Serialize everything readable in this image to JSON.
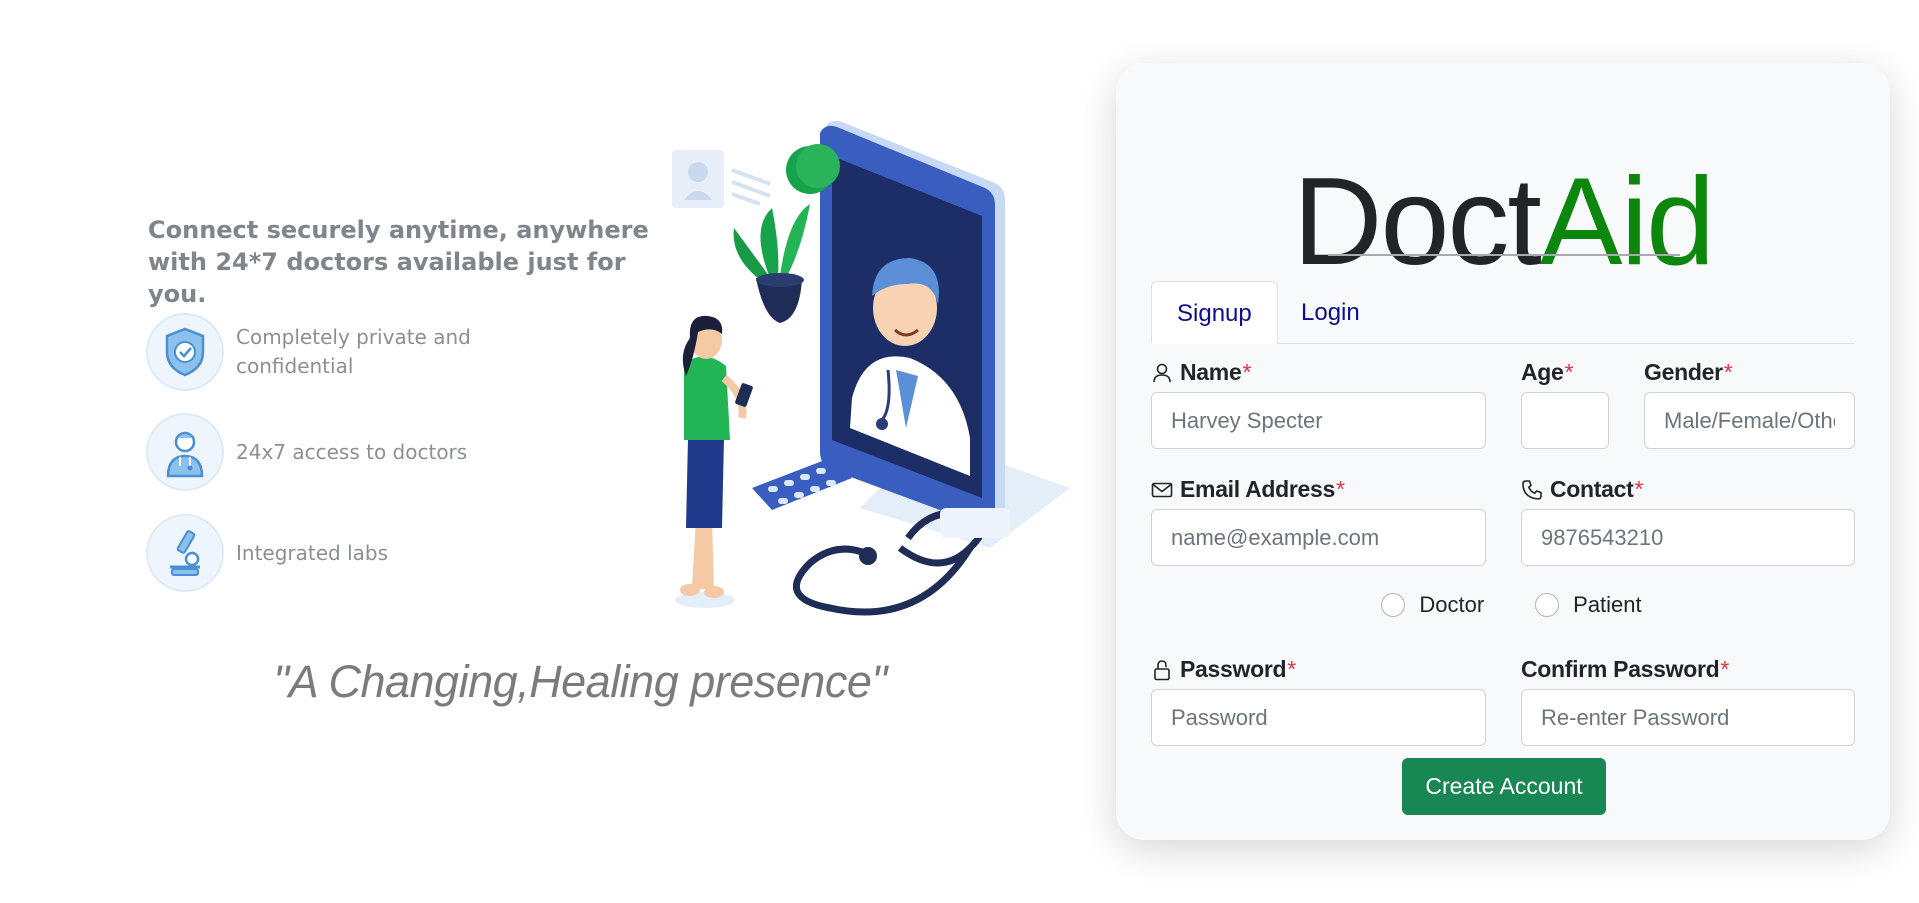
{
  "hero": {
    "heading": "Connect securely anytime, anywhere with 24*7 doctors available just for you.",
    "features": [
      {
        "icon": "shield-check-icon",
        "text": "Completely private and confidential"
      },
      {
        "icon": "doctor-icon",
        "text": "24x7 access to doctors"
      },
      {
        "icon": "microscope-icon",
        "text": "Integrated labs"
      }
    ],
    "tagline": "\"A Changing,Healing presence\""
  },
  "brand": {
    "part1": "Doct",
    "part2": "Aid"
  },
  "tabs": [
    {
      "label": "Signup",
      "active": true
    },
    {
      "label": "Login",
      "active": false
    }
  ],
  "form": {
    "required_mark": "*",
    "name": {
      "label": "Name",
      "placeholder": "Harvey Specter",
      "icon": "person-icon"
    },
    "age": {
      "label": "Age",
      "placeholder": ""
    },
    "gender": {
      "label": "Gender",
      "placeholder": "Male/Female/Others"
    },
    "email": {
      "label": "Email Address",
      "placeholder": "name@example.com",
      "icon": "envelope-icon"
    },
    "contact": {
      "label": "Contact",
      "placeholder": "9876543210",
      "icon": "phone-icon"
    },
    "roles": [
      {
        "label": "Doctor"
      },
      {
        "label": "Patient"
      }
    ],
    "password": {
      "label": "Password",
      "placeholder": "Password",
      "icon": "lock-icon"
    },
    "confirm_password": {
      "label": "Confirm Password",
      "placeholder": "Re-enter Password"
    },
    "submit_label": "Create Account"
  },
  "colors": {
    "brand_dark": "#212529",
    "brand_green": "#0c860c",
    "button": "#198754",
    "tab_text": "#0d0d8f",
    "required": "#dc3545"
  }
}
